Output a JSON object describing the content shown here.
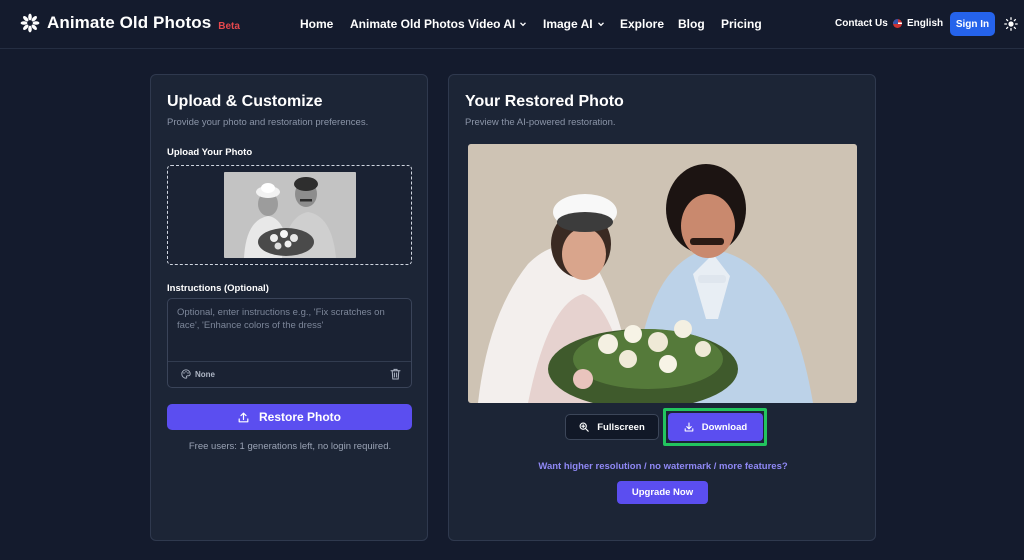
{
  "header": {
    "logo_text": "Animate Old Photos",
    "badge": "Beta",
    "nav": [
      {
        "label": "Home"
      },
      {
        "label": "Animate Old Photos"
      },
      {
        "label": "Video AI",
        "dropdown": true
      },
      {
        "label": "Image AI",
        "dropdown": true
      },
      {
        "label": "Explore"
      },
      {
        "label": "Blog"
      },
      {
        "label": "Pricing"
      }
    ],
    "contact": "Contact Us",
    "language": "English",
    "signin": "Sign In",
    "icons": {
      "logo": "flower-logo-icon",
      "language": "us-flag-icon",
      "theme": "sun-icon"
    }
  },
  "left_card": {
    "title": "Upload & Customize",
    "subtitle": "Provide your photo and restoration preferences.",
    "upload_label": "Upload Your Photo",
    "instructions_label": "Instructions (Optional)",
    "instructions_placeholder": "Optional, enter instructions e.g., 'Fix scratches on face', 'Enhance colors of the dress'",
    "style_value": "None",
    "restore_button": "Restore Photo",
    "free_note": "Free users: 1 generations left, no login required."
  },
  "right_card": {
    "title": "Your Restored Photo",
    "subtitle": "Preview the AI-powered restoration.",
    "fullscreen_button": "Fullscreen",
    "download_button": "Download",
    "upsell_text": "Want higher resolution / no watermark / more features?",
    "upgrade_button": "Upgrade Now"
  },
  "colors": {
    "background": "#141b2d",
    "card": "#1c2536",
    "accent": "#5b4ef0",
    "signin": "#2563eb",
    "beta": "#e5484d",
    "highlight": "#22c55e",
    "link": "#8f88f5"
  }
}
